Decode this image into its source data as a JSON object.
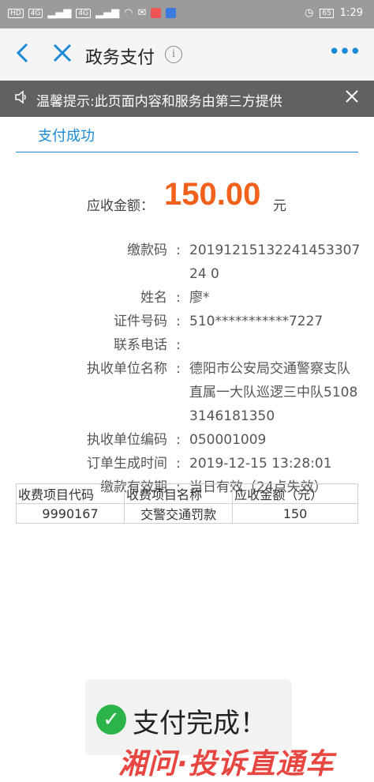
{
  "status_bar": {
    "left_badges": [
      "HD",
      "4G",
      "4G"
    ],
    "battery": "65",
    "time": "1:29"
  },
  "nav": {
    "title": "政务支付",
    "info_glyph": "i",
    "more_glyph": "•••"
  },
  "notice": {
    "text": "温馨提示:此页面内容和服务由第三方提供"
  },
  "tab": {
    "label": "支付成功"
  },
  "amount": {
    "label": "应收金额：",
    "value": "150.00",
    "unit": "元"
  },
  "details": [
    {
      "label": "缴款码",
      "value": "2019121513224145330724 0"
    },
    {
      "label": "姓名",
      "value": "廖*"
    },
    {
      "label": "证件号码",
      "value": "510***********7227"
    },
    {
      "label": "联系电话",
      "value": ""
    },
    {
      "label": "执收单位名称",
      "value": "德阳市公安局交通警察支队直属一大队巡逻三中队51083146181350"
    },
    {
      "label": "执收单位编码",
      "value": "050001009"
    },
    {
      "label": "订单生成时间",
      "value": "2019-12-15 13:28:01"
    },
    {
      "label": "缴款有效期",
      "value": "当日有效（24点失效）"
    }
  ],
  "fee_table": {
    "headers": [
      "收费项目代码",
      "收费项目名称",
      "应收金额（元）"
    ],
    "rows": [
      [
        "9990167",
        "交警交通罚款",
        "150"
      ]
    ]
  },
  "toast": {
    "text": "支付完成！"
  },
  "watermark": {
    "text": "湘问·投诉直通车"
  },
  "colors": {
    "accent": "#1a8ad6",
    "amount": "#f2611c",
    "success": "#2bb44a",
    "notice_bg": "#616161"
  }
}
